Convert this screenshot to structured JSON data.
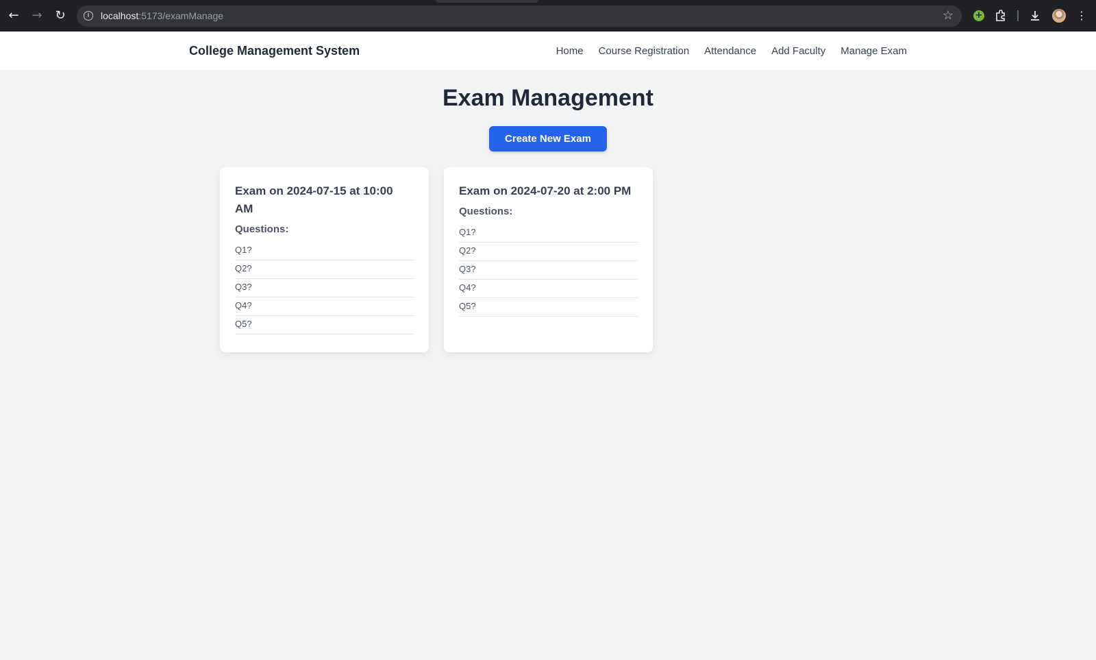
{
  "browser": {
    "url_host": "localhost",
    "url_path": ":5173/examManage",
    "icons": [
      "back-icon",
      "forward-icon",
      "reload-icon",
      "info-icon",
      "star-icon",
      "extension-icon",
      "puzzle-icon",
      "download-icon",
      "avatar",
      "menu-icon"
    ]
  },
  "navbar": {
    "brand": "College Management System",
    "links": [
      {
        "label": "Home"
      },
      {
        "label": "Course Registration"
      },
      {
        "label": "Attendance"
      },
      {
        "label": "Add Faculty"
      },
      {
        "label": "Manage Exam"
      }
    ]
  },
  "main": {
    "title": "Exam Management",
    "create_button": "Create New Exam",
    "exams": [
      {
        "title": "Exam on 2024-07-15 at 10:00 AM",
        "questions_label": "Questions:",
        "questions": [
          "Q1?",
          "Q2?",
          "Q3?",
          "Q4?",
          "Q5?"
        ]
      },
      {
        "title": "Exam on 2024-07-20 at 2:00 PM",
        "questions_label": "Questions:",
        "questions": [
          "Q1?",
          "Q2?",
          "Q3?",
          "Q4?",
          "Q5?"
        ]
      }
    ]
  },
  "colors": {
    "primary_button": "#2563eb",
    "page_background": "#f3f4f6",
    "browser_chrome": "#202124"
  }
}
